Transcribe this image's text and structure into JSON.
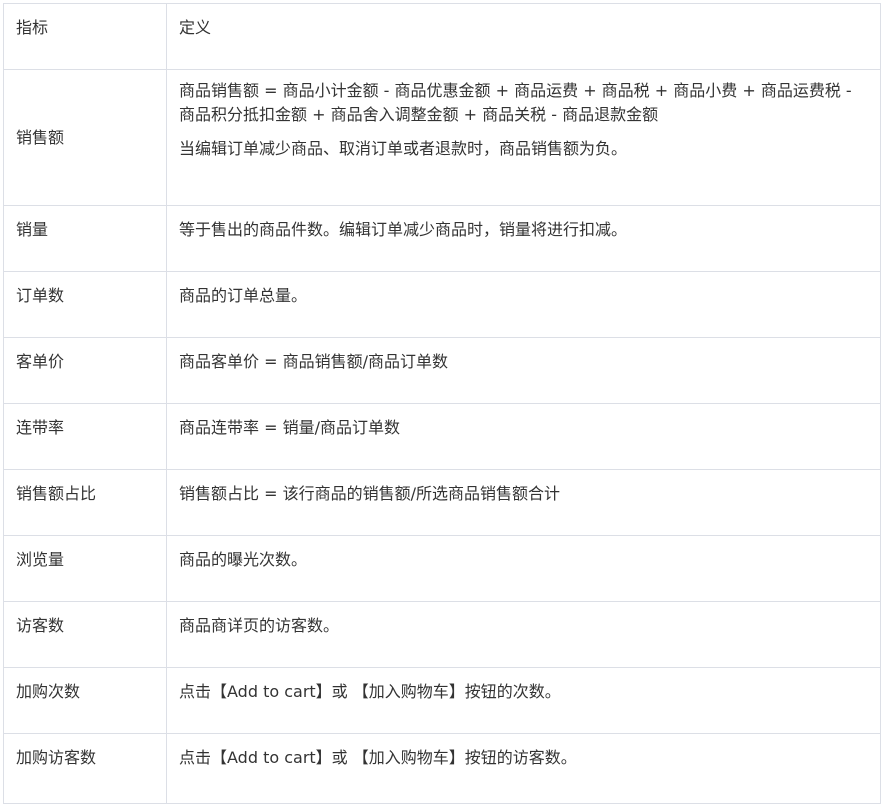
{
  "header": {
    "metric": "指标",
    "definition": "定义"
  },
  "rows": [
    {
      "metric": "销售额",
      "def1": "商品销售额 = 商品小计金额 - 商品优惠金额 + 商品运费 + 商品税 + 商品小费 + 商品运费税 - 商品积分抵扣金额 + 商品舍入调整金额 + 商品关税 - 商品退款金额",
      "def2": "当编辑订单减少商品、取消订单或者退款时，商品销售额为负。"
    },
    {
      "metric": "销量",
      "def": "等于售出的商品件数。编辑订单减少商品时，销量将进行扣减。"
    },
    {
      "metric": "订单数",
      "def": "商品的订单总量。"
    },
    {
      "metric": "客单价",
      "def": "商品客单价 = 商品销售额/商品订单数"
    },
    {
      "metric": "连带率",
      "def": "商品连带率 = 销量/商品订单数"
    },
    {
      "metric": "销售额占比",
      "def": "销售额占比 = 该行商品的销售额/所选商品销售额合计"
    },
    {
      "metric": "浏览量",
      "def": "商品的曝光次数。"
    },
    {
      "metric": "访客数",
      "def": "商品商详页的访客数。"
    },
    {
      "metric": "加购次数",
      "def": "点击【Add to cart】或 【加入购物车】按钮的次数。"
    },
    {
      "metric": "加购访客数",
      "def": "点击【Add to cart】或 【加入购物车】按钮的访客数。"
    }
  ]
}
